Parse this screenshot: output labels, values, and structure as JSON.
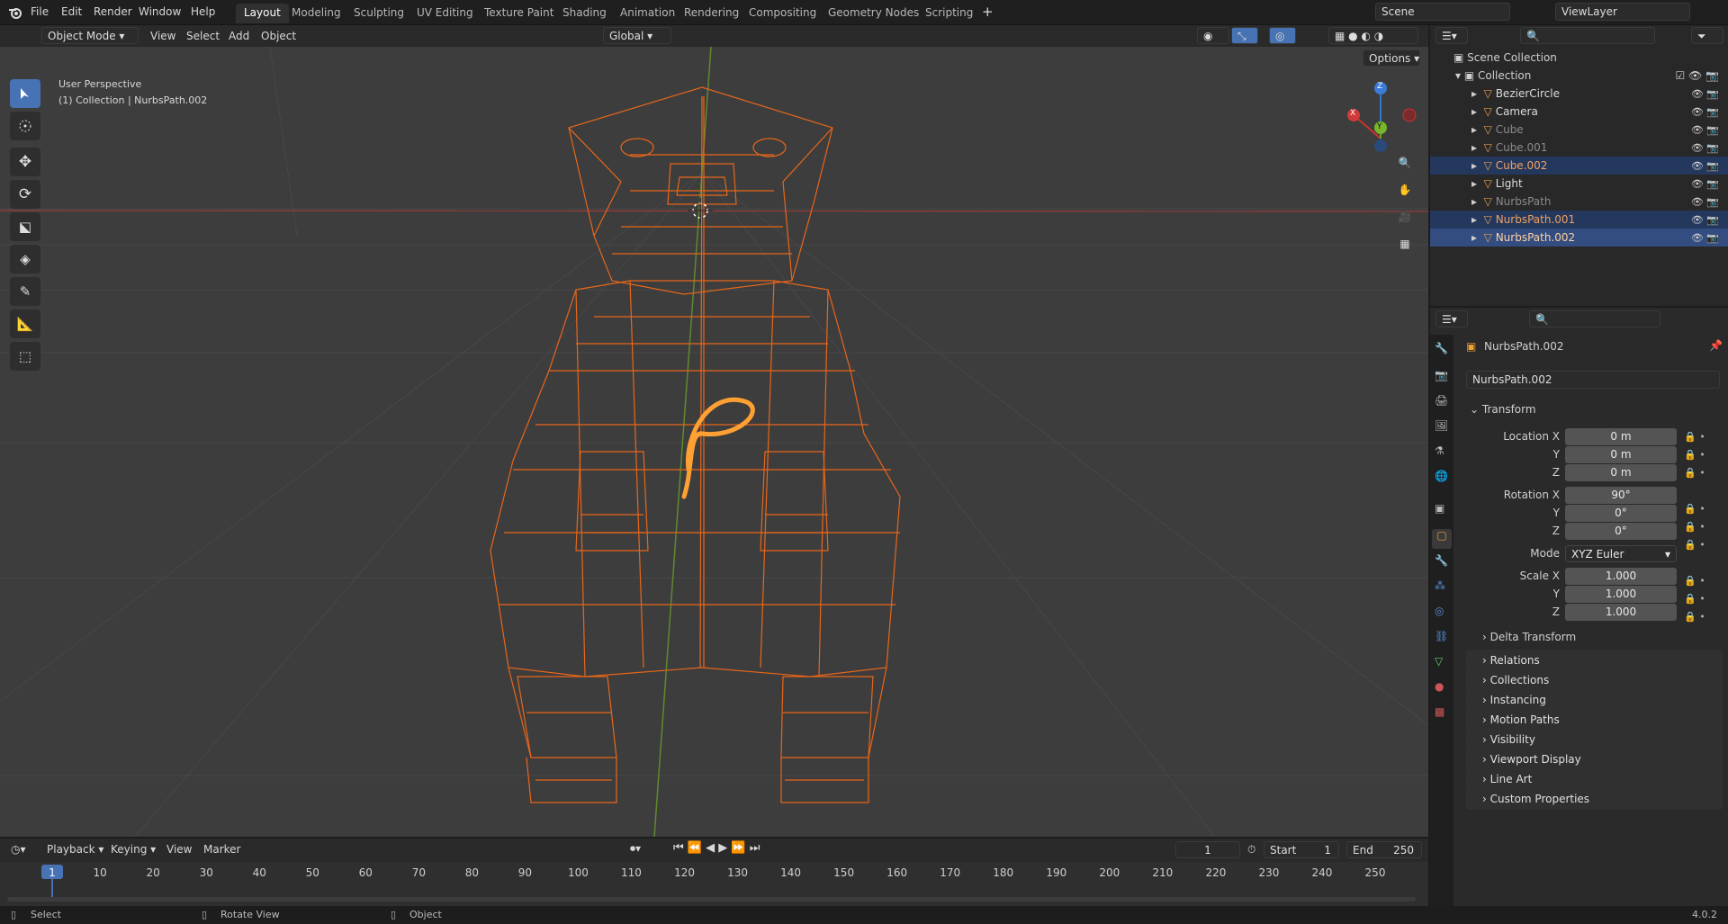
{
  "topbar": {
    "menus": [
      "File",
      "Edit",
      "Render",
      "Window",
      "Help"
    ],
    "workspaces": [
      "Layout",
      "Modeling",
      "Sculpting",
      "UV Editing",
      "Texture Paint",
      "Shading",
      "Animation",
      "Rendering",
      "Compositing",
      "Geometry Nodes",
      "Scripting"
    ],
    "active_workspace": "Layout",
    "scene": "Scene",
    "view_layer": "ViewLayer"
  },
  "viewport_header": {
    "mode": "Object Mode",
    "menus": [
      "View",
      "Select",
      "Add",
      "Object"
    ],
    "orientation": "Global",
    "options": "Options"
  },
  "viewport": {
    "perspective": "User Perspective",
    "context": "(1) Collection | NurbsPath.002",
    "gizmo": {
      "x": "X",
      "y": "Y",
      "z": "Z"
    }
  },
  "outliner": {
    "scene_collection": "Scene Collection",
    "collection": "Collection",
    "items": [
      {
        "name": "BezierCircle",
        "style": "normal"
      },
      {
        "name": "Camera",
        "style": "normal"
      },
      {
        "name": "Cube",
        "style": "dim"
      },
      {
        "name": "Cube.001",
        "style": "dim"
      },
      {
        "name": "Cube.002",
        "style": "selected"
      },
      {
        "name": "Light",
        "style": "normal"
      },
      {
        "name": "NurbsPath",
        "style": "dim"
      },
      {
        "name": "NurbsPath.001",
        "style": "selected"
      },
      {
        "name": "NurbsPath.002",
        "style": "active"
      }
    ]
  },
  "properties": {
    "object_name": "NurbsPath.002",
    "object_field": "NurbsPath.002",
    "transform_title": "Transform",
    "location": {
      "label": "Location X",
      "x": "0 m",
      "y": "0 m",
      "z": "0 m"
    },
    "rotation": {
      "label": "Rotation X",
      "x": "90°",
      "y": "0°",
      "z": "0°"
    },
    "mode_label": "Mode",
    "mode_value": "XYZ Euler",
    "scale": {
      "label": "Scale X",
      "x": "1.000",
      "y": "1.000",
      "z": "1.000"
    },
    "axis_y": "Y",
    "axis_z": "Z",
    "delta": "Delta Transform",
    "panels": [
      "Relations",
      "Collections",
      "Instancing",
      "Motion Paths",
      "Visibility",
      "Viewport Display",
      "Line Art",
      "Custom Properties"
    ]
  },
  "timeline": {
    "menus": [
      "Playback",
      "Keying",
      "View",
      "Marker"
    ],
    "current_frame": "1",
    "start_label": "Start",
    "start": "1",
    "end_label": "End",
    "end": "250",
    "ticks": [
      "1",
      "10",
      "20",
      "30",
      "40",
      "50",
      "60",
      "70",
      "80",
      "90",
      "100",
      "110",
      "120",
      "130",
      "140",
      "150",
      "160",
      "170",
      "180",
      "190",
      "200",
      "210",
      "220",
      "230",
      "240",
      "250"
    ]
  },
  "status": {
    "select": "Select",
    "rotate": "Rotate View",
    "object": "Object",
    "version": "4.0.2"
  },
  "colors": {
    "accent": "#4772b3",
    "selection_orange": "#e8661a",
    "active_orange": "#ffa033"
  }
}
